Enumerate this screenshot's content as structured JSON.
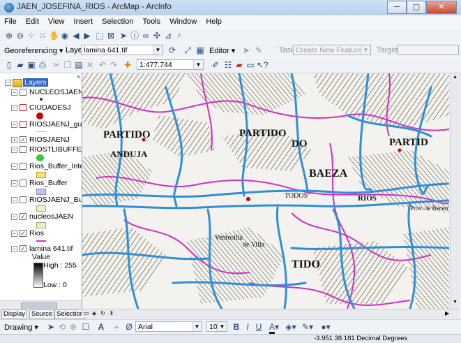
{
  "window": {
    "title": "JAEN_JOSEFINA_RIOS - ArcMap - ArcInfo",
    "minimize": "─",
    "maximize": "▢",
    "close": "✕"
  },
  "menu": [
    "File",
    "Edit",
    "View",
    "Insert",
    "Selection",
    "Tools",
    "Window",
    "Help"
  ],
  "georef": {
    "label": "Georeferencing ▾",
    "layer_label": "Layer:",
    "layer_value": "lamina 641.tif"
  },
  "editor": {
    "label": "Editor ▾",
    "task_label": "Task:",
    "task_value": "Create New Feature",
    "target_label": "Target:"
  },
  "standard": {
    "scale": "1:477.744"
  },
  "toc": {
    "root": "Layers",
    "layers": [
      {
        "name": "NUCLEOSJAENIKI",
        "checked": false
      },
      {
        "name": "CIUDADESJ",
        "checked": false
      },
      {
        "name": "RIOSJAENJ_guada",
        "checked": false
      },
      {
        "name": "RIOSJAENJ",
        "checked": true
      },
      {
        "name": "RIOSTLIBUFFERIN",
        "checked": false
      },
      {
        "name": "Rios_Buffer_Inters",
        "checked": false
      },
      {
        "name": "Rios_Buffer",
        "checked": false
      },
      {
        "name": "RIOSJAENJ_Buffer",
        "checked": false
      },
      {
        "name": "nucleosJAEN",
        "checked": true
      },
      {
        "name": "Rios",
        "checked": true
      },
      {
        "name": "lamina 641.tif",
        "checked": true
      }
    ],
    "raster_value": "Value",
    "raster_high": "High : 255",
    "raster_low": "Low : 0",
    "tabs": [
      "Display",
      "Source",
      "Selection"
    ]
  },
  "map_labels": [
    "PARTIDO",
    "DO",
    "PARTID",
    "ANDUJA",
    "BAEZA",
    "RIOS",
    "PARTIDO",
    "TIDO",
    "Prov. de Becerra",
    "de Villa",
    "TODOS",
    "Ventosilla"
  ],
  "drawing": {
    "label": "Drawing ▾",
    "font": "Arial",
    "size": "10",
    "bold": "B",
    "italic": "I",
    "underline": "U"
  },
  "status": {
    "coords": "-3.951  38.181 Decimal Degrees"
  },
  "colors": {
    "river": "#2f8fd6",
    "boundary": "#d12fbe",
    "cities": "#cc0000",
    "buffer_green": "#33cc33",
    "buffer_yellow": "#f6e27a",
    "buffer_lilac": "#c7c2f2",
    "buffer_pale": "#e8f2c8"
  }
}
